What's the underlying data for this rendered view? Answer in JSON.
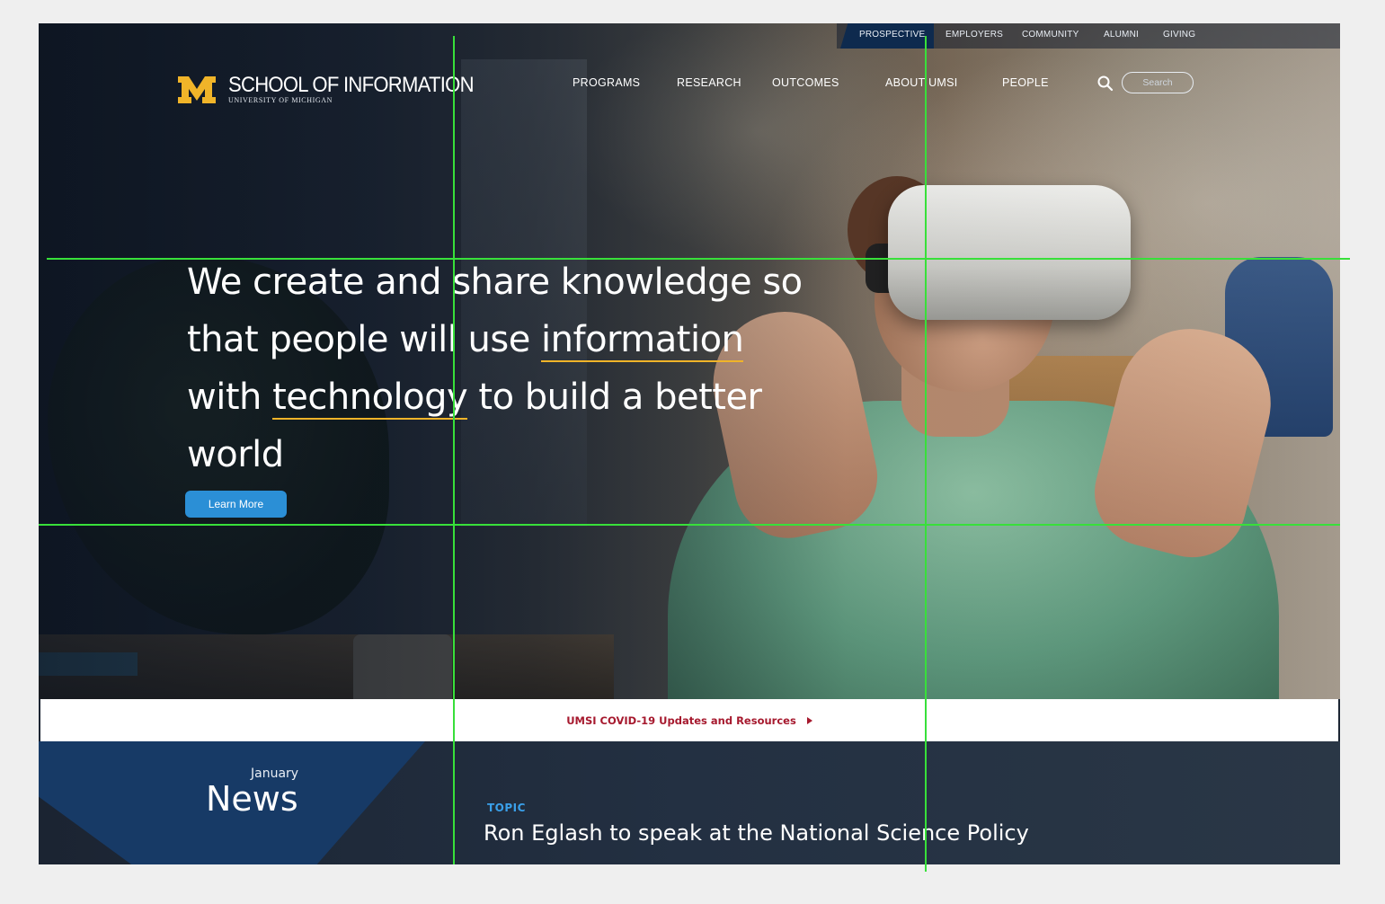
{
  "utility_nav": {
    "items": [
      "PROSPECTIVE",
      "EMPLOYERS",
      "COMMUNITY",
      "ALUMNI",
      "GIVING"
    ],
    "active": "PROSPECTIVE"
  },
  "brand": {
    "title": "SCHOOL OF INFORMATION",
    "subtitle": "UNIVERSITY OF MICHIGAN",
    "maize": "#f0b429",
    "blue": "#0e2a4e"
  },
  "main_nav": {
    "items": [
      "PROGRAMS",
      "RESEARCH",
      "OUTCOMES",
      "ABOUT UMSI",
      "PEOPLE"
    ]
  },
  "search": {
    "placeholder": "Search",
    "icon": "search-icon"
  },
  "hero": {
    "headline_parts": {
      "a": "We create and share knowledge so",
      "b": "that people will use ",
      "c": "information",
      "d": "with ",
      "e": "technology",
      "f": " to build a better",
      "g": "world"
    },
    "cta_label": "Learn More"
  },
  "alert_bar": {
    "text": "UMSI COVID-19 Updates and Resources",
    "color": "#a6192e"
  },
  "news": {
    "month": "January",
    "title": "News",
    "topic": "TOPIC",
    "story": "Ron Eglash to speak at the National Science Policy"
  },
  "overlay": {
    "guide_color": "#38e03a"
  }
}
